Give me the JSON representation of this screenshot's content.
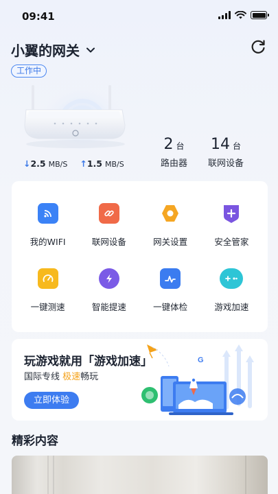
{
  "status_bar": {
    "time": "09:41"
  },
  "header": {
    "title": "小翼的网关",
    "status_badge": "工作中"
  },
  "speeds": {
    "down": {
      "value": "2.5",
      "unit": "MB/S"
    },
    "up": {
      "value": "1.5",
      "unit": "MB/S"
    }
  },
  "stats": [
    {
      "value": "2",
      "unit": "台",
      "label": "路由器"
    },
    {
      "value": "14",
      "unit": "台",
      "label": "联网设备"
    }
  ],
  "features": [
    {
      "label": "我的WIFI",
      "icon": "wifi-icon",
      "color": "#3b82f6"
    },
    {
      "label": "联网设备",
      "icon": "link-icon",
      "color": "#f06a48"
    },
    {
      "label": "网关设置",
      "icon": "gear-icon",
      "color": "#f5a623"
    },
    {
      "label": "安全管家",
      "icon": "shield-icon",
      "color": "#7a55e0"
    },
    {
      "label": "一键测速",
      "icon": "speedometer-icon",
      "color": "#f7b91e"
    },
    {
      "label": "智能提速",
      "icon": "lightning-icon",
      "color": "#7b5be6"
    },
    {
      "label": "一键体检",
      "icon": "health-check-icon",
      "color": "#3b7cf0"
    },
    {
      "label": "游戏加速",
      "icon": "gamepad-icon",
      "color": "#2ec5d6"
    }
  ],
  "banner": {
    "title": "玩游戏就用「游戏加速」",
    "subtitle_prefix": "国际专线",
    "subtitle_accent": "极速",
    "subtitle_suffix": "畅玩",
    "cta": "立即体验"
  },
  "section": {
    "title": "精彩内容"
  },
  "colors": {
    "primary": "#3d7cf0",
    "accent": "#f4a21a"
  }
}
